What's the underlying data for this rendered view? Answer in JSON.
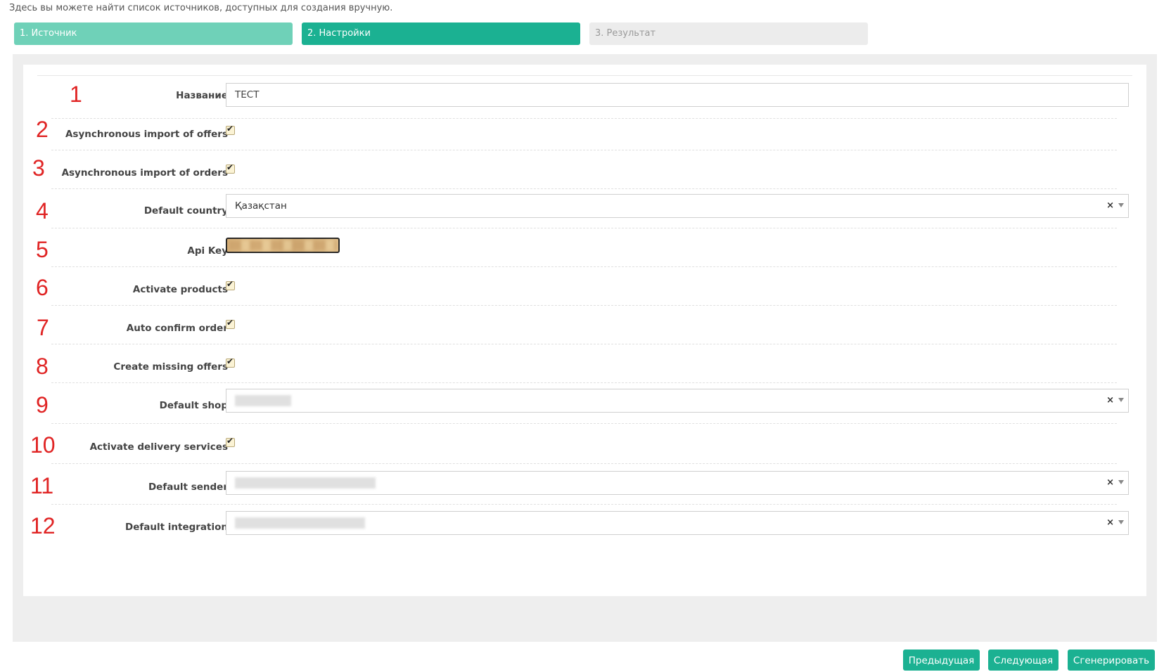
{
  "intro_text": "Здесь вы можете найти список источников, доступных для создания вручную.",
  "steps": [
    {
      "label": "1. Источник"
    },
    {
      "label": "2. Настройки"
    },
    {
      "label": "3. Результат"
    }
  ],
  "fields": {
    "name": {
      "number": "1",
      "label": "Название",
      "value": "ТЕСТ"
    },
    "async_offers": {
      "number": "2",
      "label": "Asynchronous import of offers",
      "checked": true
    },
    "async_orders": {
      "number": "3",
      "label": "Asynchronous import of orders",
      "checked": true
    },
    "default_country": {
      "number": "4",
      "label": "Default country",
      "value": "Қазақстан",
      "clear": "×"
    },
    "api_key": {
      "number": "5",
      "label": "Api Key"
    },
    "activate_products": {
      "number": "6",
      "label": "Activate products",
      "checked": true
    },
    "auto_confirm": {
      "number": "7",
      "label": "Auto confirm order",
      "checked": true
    },
    "create_missing": {
      "number": "8",
      "label": "Create missing offers",
      "checked": true
    },
    "default_shop": {
      "number": "9",
      "label": "Default shop",
      "clear": "×"
    },
    "activate_delivery": {
      "number": "10",
      "label": "Activate delivery services",
      "checked": true
    },
    "default_sender": {
      "number": "11",
      "label": "Default sender",
      "clear": "×"
    },
    "default_integration": {
      "number": "12",
      "label": "Default integration",
      "clear": "×"
    }
  },
  "check_glyph": "✔",
  "buttons": {
    "prev": "Предыдущая",
    "next": "Следующая",
    "generate": "Сгенерировать"
  },
  "colors": {
    "accent": "#1bb192",
    "step_done": "#6fd1b8",
    "step_pending": "#ececec",
    "annotation": "#e02424"
  }
}
